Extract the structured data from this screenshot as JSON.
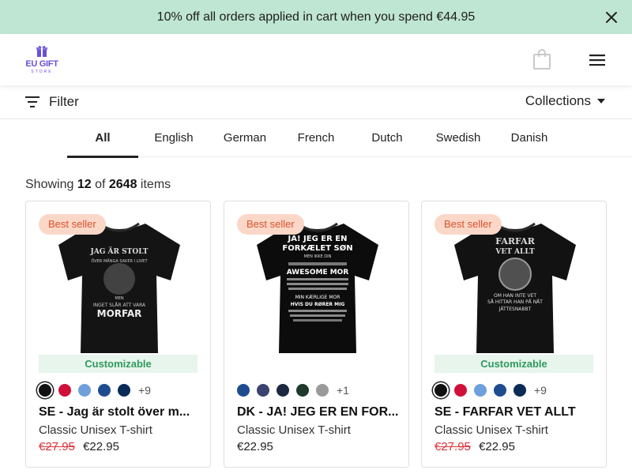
{
  "promo": {
    "text": "10% off all orders applied in cart when you spend €44.95"
  },
  "header": {
    "logo_text": "EU GIFT",
    "logo_sub": "STORE"
  },
  "filterbar": {
    "filter_label": "Filter",
    "collections_label": "Collections"
  },
  "tabs": [
    {
      "label": "All",
      "active": true
    },
    {
      "label": "English"
    },
    {
      "label": "German"
    },
    {
      "label": "French"
    },
    {
      "label": "Dutch"
    },
    {
      "label": "Swedish"
    },
    {
      "label": "Danish"
    }
  ],
  "results": {
    "prefix": "Showing",
    "shown": "12",
    "of": "of",
    "total": "2648",
    "suffix": "items"
  },
  "products": [
    {
      "badge": "Best seller",
      "customizable": "Customizable",
      "swatches": [
        "#111111",
        "#d0103a",
        "#6fa0dc",
        "#1e4c8f",
        "#0b2a57"
      ],
      "more": "+9",
      "title": "SE - Jag är stolt över m...",
      "subtitle": "Classic Unisex T-shirt",
      "old_price": "€27.95",
      "price": "€22.95",
      "shirt_lines": [
        "JAG ÄR STOLT",
        "ÖVER MÅNGA SAKER I LIVET",
        "MEN",
        "INGET SLÅR ATT VARA",
        "MORFAR"
      ]
    },
    {
      "badge": "Best seller",
      "customizable": "",
      "swatches": [
        "#1e4c8f",
        "#3b4270",
        "#1c2840",
        "#1f3a2c",
        "#9a9a9a"
      ],
      "more": "+1",
      "title": "DK - JA! JEG ER EN FOR...",
      "subtitle": "Classic Unisex T-shirt",
      "old_price": "",
      "price": "€22.95",
      "shirt_lines": [
        "JA! JEG ER EN",
        "FORKÆLET SØN",
        "MEN IKKE DIN",
        "AWESOME MOR",
        "MIN KÆRLIGE MOR",
        "HVIS DU RØRER MIG"
      ]
    },
    {
      "badge": "Best seller",
      "customizable": "Customizable",
      "swatches": [
        "#111111",
        "#d0103a",
        "#6fa0dc",
        "#1e4c8f",
        "#0b2a57"
      ],
      "more": "+9",
      "title": "SE - FARFAR VET ALLT",
      "subtitle": "Classic Unisex T-shirt",
      "old_price": "€27.95",
      "price": "€22.95",
      "shirt_lines": [
        "FARFAR",
        "VET ALLT",
        "OM HAN INTE VET",
        "SÅ HITTAR HAN PÅ NÅT",
        "JÄTTESNABBT"
      ]
    }
  ],
  "colors": {
    "promo_bg": "#bfe6d2",
    "badge_bg": "#fbd7c8",
    "badge_text": "#d9522c",
    "custom_bg": "#e7f5ec",
    "custom_text": "#2f9a5e",
    "sale": "#d9333a",
    "brand": "#6b4fd8"
  },
  "icons": {
    "close": "close-icon",
    "bag": "shopping-bag-icon",
    "menu": "hamburger-menu-icon",
    "filter": "filter-icon",
    "dropdown": "caret-down-icon"
  }
}
